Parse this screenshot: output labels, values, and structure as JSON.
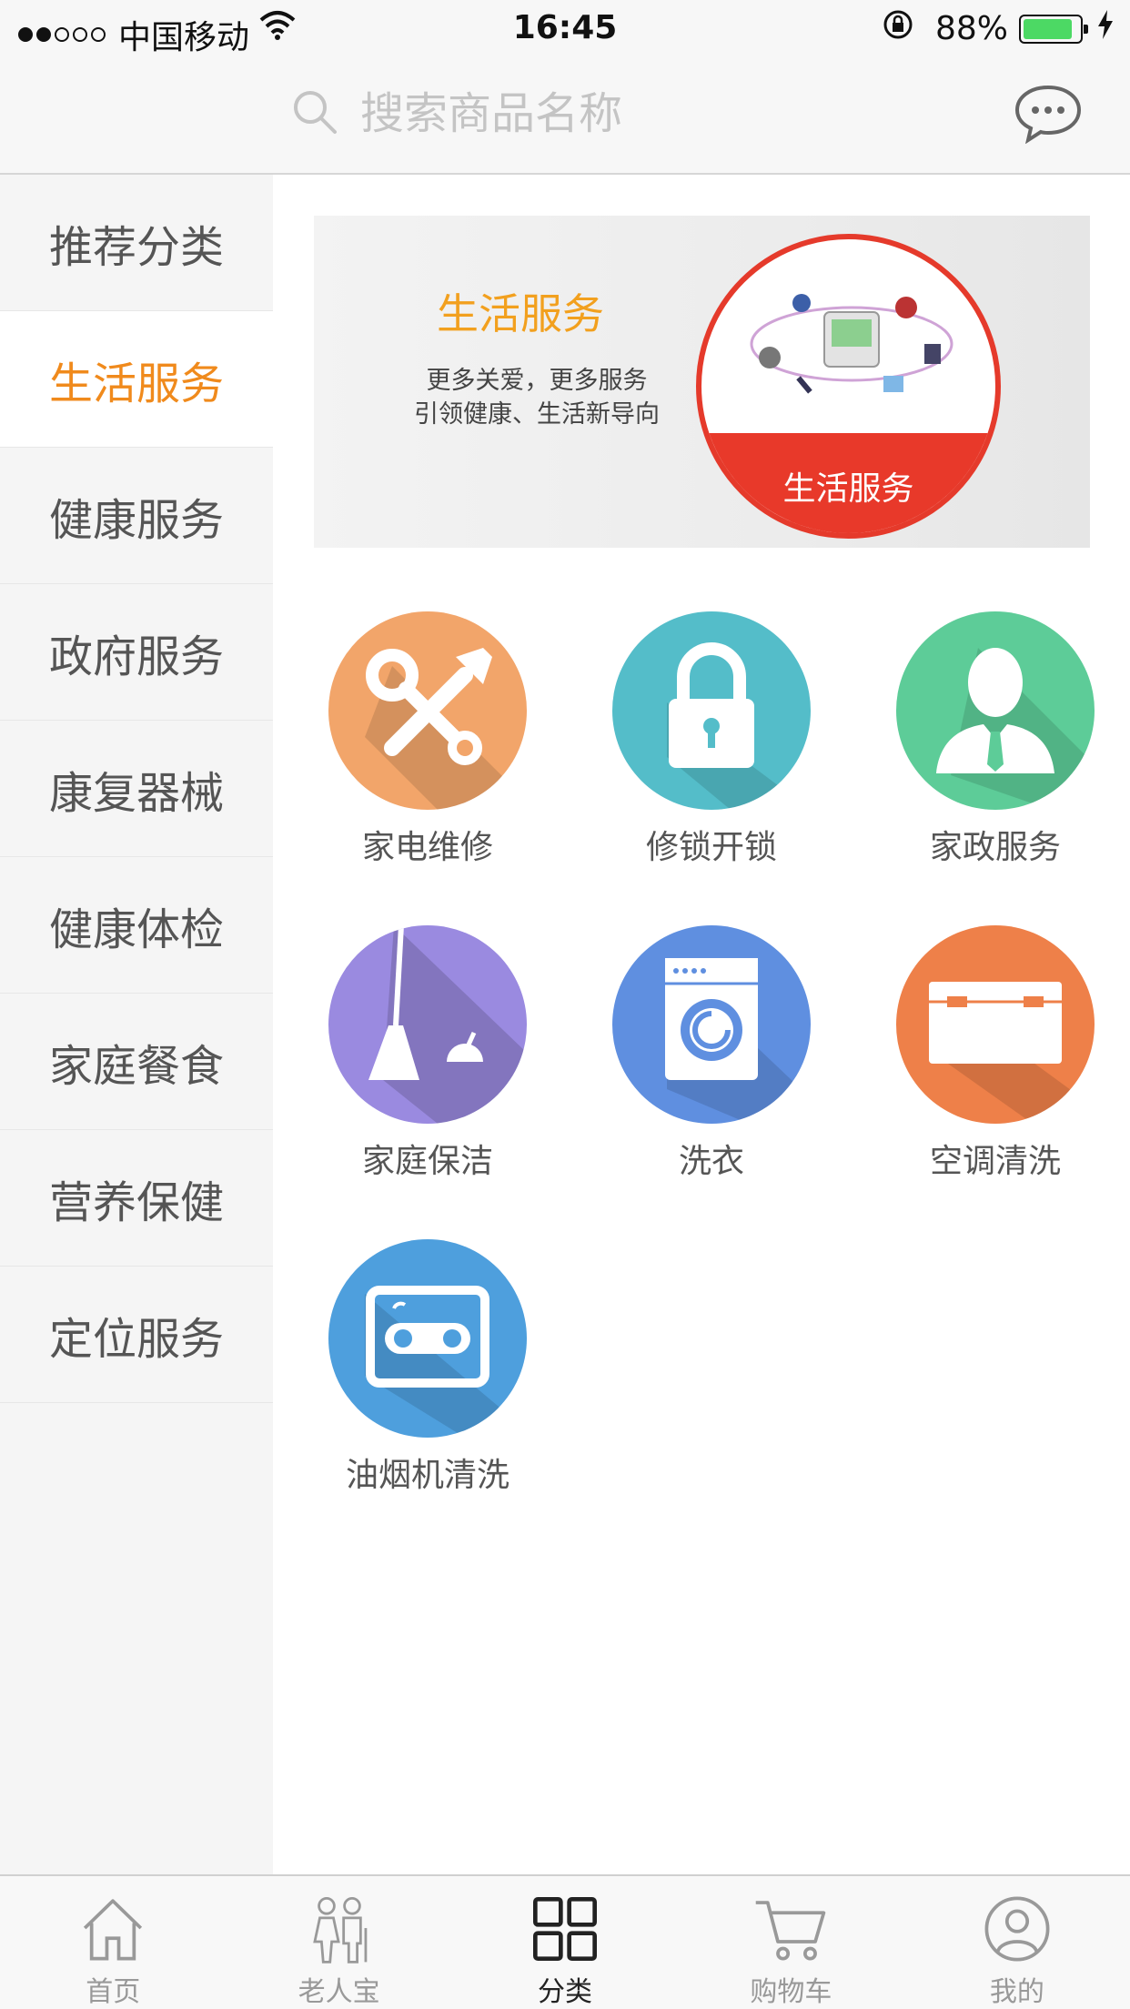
{
  "status_bar": {
    "carrier": "中国移动",
    "time": "16:45",
    "battery": "88%",
    "battery_level": 0.88
  },
  "search": {
    "placeholder": "搜索商品名称"
  },
  "sidebar": {
    "items": [
      {
        "label": "推荐分类"
      },
      {
        "label": "生活服务",
        "active": true
      },
      {
        "label": "健康服务"
      },
      {
        "label": "政府服务"
      },
      {
        "label": "康复器械"
      },
      {
        "label": "健康体检"
      },
      {
        "label": "家庭餐食"
      },
      {
        "label": "营养保健"
      },
      {
        "label": "定位服务"
      }
    ]
  },
  "banner": {
    "title": "生活服务",
    "subtitle_line1": "更多关爱，更多服务",
    "subtitle_line2": "引领健康、生活新导向",
    "badge": "生活服务"
  },
  "services": [
    {
      "label": "家电维修",
      "icon": "wrench-screwdriver-icon",
      "color": "#f2a56a"
    },
    {
      "label": "修锁开锁",
      "icon": "padlock-icon",
      "color": "#54bdc9"
    },
    {
      "label": "家政服务",
      "icon": "person-icon",
      "color": "#5dcc98"
    },
    {
      "label": "家庭保洁",
      "icon": "broom-icon",
      "color": "#9a8ae0"
    },
    {
      "label": "洗衣",
      "icon": "washing-machine-icon",
      "color": "#5f8fe0"
    },
    {
      "label": "空调清洗",
      "icon": "air-conditioner-icon",
      "color": "#ee8049"
    },
    {
      "label": "油烟机清洗",
      "icon": "range-hood-icon",
      "color": "#4e9fdd"
    }
  ],
  "tabbar": {
    "items": [
      {
        "label": "首页",
        "icon": "home-icon"
      },
      {
        "label": "老人宝",
        "icon": "elderly-couple-icon"
      },
      {
        "label": "分类",
        "icon": "grid-icon",
        "active": true
      },
      {
        "label": "购物车",
        "icon": "cart-icon"
      },
      {
        "label": "我的",
        "icon": "profile-icon"
      }
    ]
  },
  "colors": {
    "accent": "#f08a1c",
    "banner_red": "#e8392a"
  }
}
